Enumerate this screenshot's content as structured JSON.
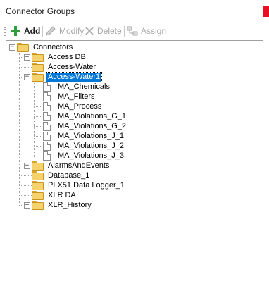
{
  "panel": {
    "title": "Connector Groups"
  },
  "toolbar": {
    "add_label": "Add",
    "modify_label": "Modify",
    "delete_label": "Delete",
    "assign_label": "Assign"
  },
  "tree": {
    "root": "Connectors",
    "groups": [
      {
        "label": "Access DB",
        "expanded": false
      },
      {
        "label": "Access-Water",
        "expanded": false
      },
      {
        "label": "Access-Water1",
        "expanded": true,
        "selected": true,
        "children": [
          "MA_Chemicals",
          "MA_Filters",
          "MA_Process",
          "MA_Violations_G_1",
          "MA_Violations_G_2",
          "MA_Violations_J_1",
          "MA_Violations_J_2",
          "MA_Violations_J_3"
        ]
      },
      {
        "label": "AlarmsAndEvents",
        "expanded": false
      },
      {
        "label": "Database_1",
        "expanded": false
      },
      {
        "label": "PLX51 Data Logger_1",
        "expanded": false
      },
      {
        "label": "XLR DA",
        "expanded": false
      },
      {
        "label": "XLR_History",
        "expanded": false
      }
    ]
  },
  "colors": {
    "selection": "#0078d7",
    "folder": "#f5d26b",
    "add_icon": "#2e9e3a",
    "close": "#e81123"
  },
  "icons": {
    "add": "plus-icon",
    "modify": "pencil-icon",
    "delete": "x-icon",
    "assign": "assign-icon",
    "folder": "folder-icon",
    "document": "document-icon",
    "expand": "plus-expander-icon",
    "collapse": "minus-expander-icon"
  }
}
